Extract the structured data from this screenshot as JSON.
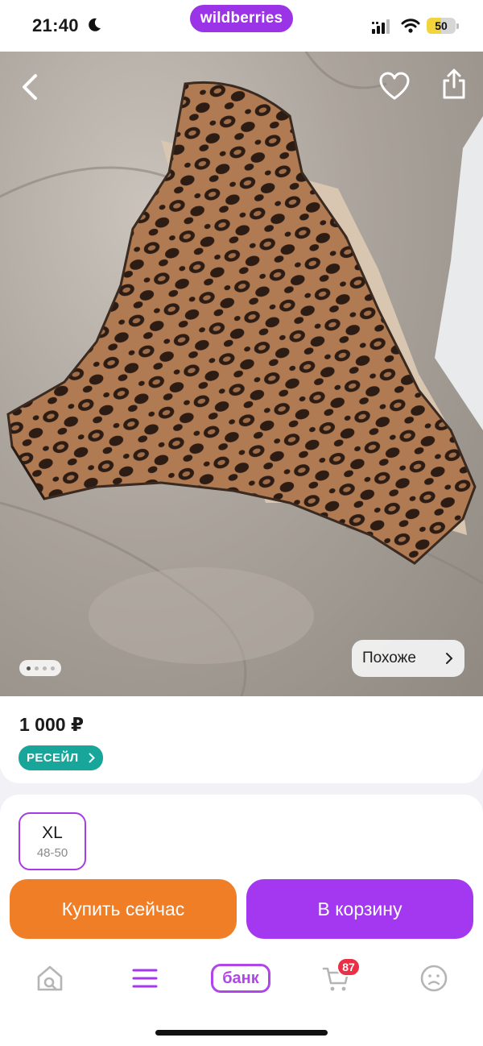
{
  "status_bar": {
    "time": "21:40",
    "brand": "wildberries",
    "battery_level": "50",
    "brand_color": "#9b33e6"
  },
  "product_image": {
    "similar_label": "Похоже",
    "gallery_count": 4,
    "gallery_active_index": 0
  },
  "product": {
    "price": "1 000 ₽",
    "badge": "РЕСЕЙЛ",
    "badge_color": "#18a59a"
  },
  "sizes": [
    {
      "size": "XL",
      "range": "48-50",
      "selected": true
    }
  ],
  "actions": {
    "buy_now_label": "Купить сейчас",
    "buy_now_color": "#f07e27",
    "add_to_cart_label": "В корзину",
    "add_to_cart_color": "#a338f0"
  },
  "tabbar": {
    "items": [
      {
        "name": "home-search",
        "icon": "home-search-icon"
      },
      {
        "name": "catalog",
        "icon": "menu-icon"
      },
      {
        "name": "bank",
        "label": "банк"
      },
      {
        "name": "cart",
        "icon": "cart-icon",
        "badge": "87"
      },
      {
        "name": "profile",
        "icon": "profile-icon"
      }
    ]
  }
}
